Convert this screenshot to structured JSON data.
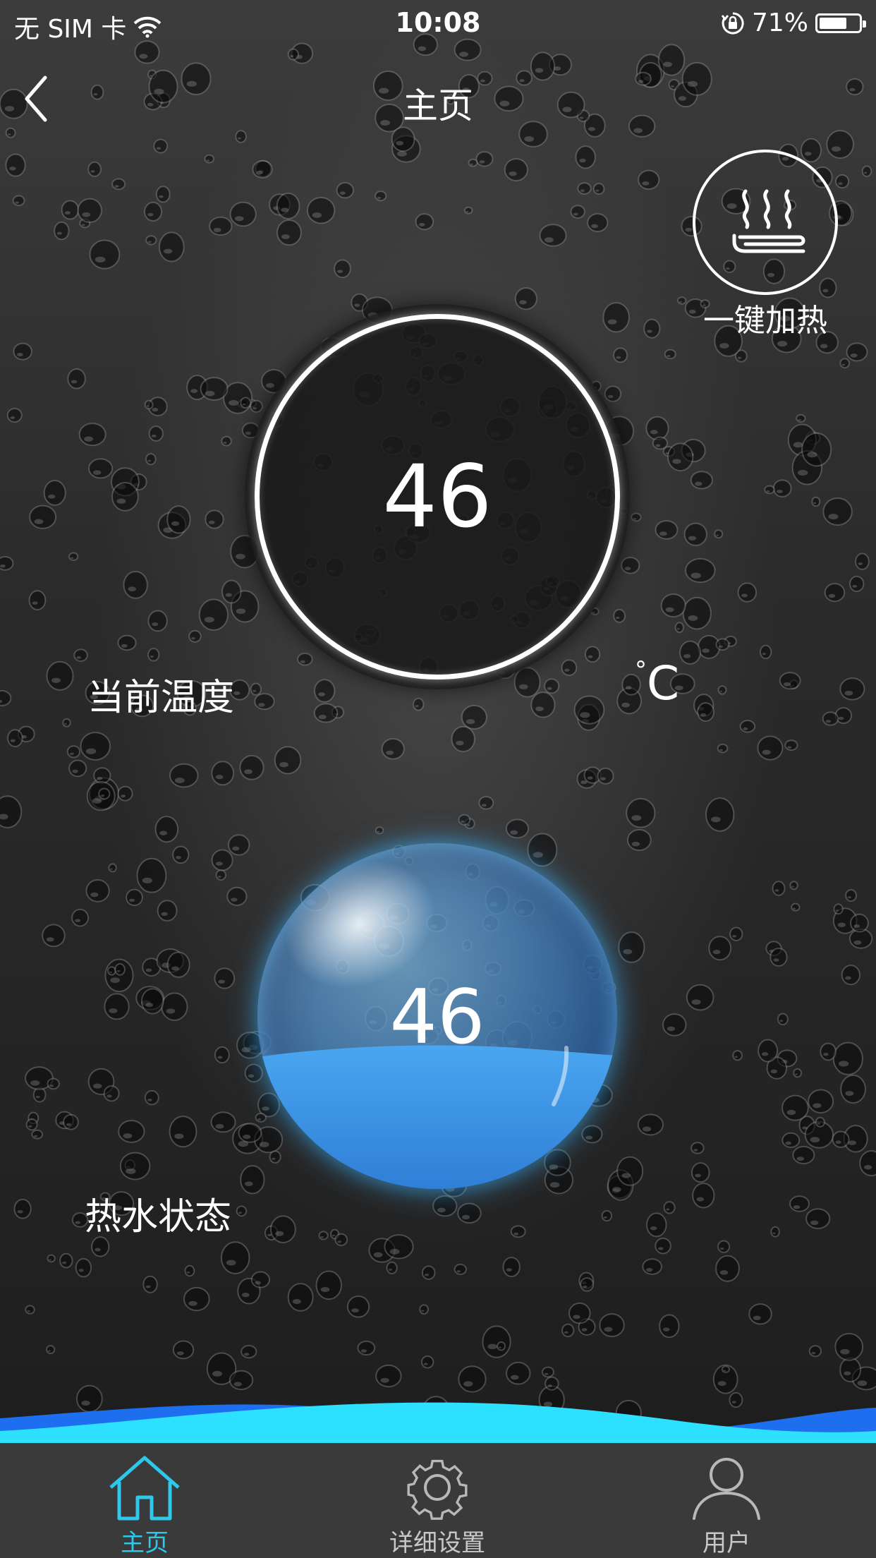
{
  "status_bar": {
    "carrier": "无 SIM 卡",
    "time": "10:08",
    "battery_percent": "71%",
    "battery_level": 0.71,
    "icons": [
      "wifi-icon",
      "rotation-lock-icon",
      "battery-icon"
    ]
  },
  "nav": {
    "title": "主页",
    "back_icon": "chevron-left-icon"
  },
  "quick_heat": {
    "label": "一键加热",
    "icon": "heat-wave-icon"
  },
  "temperature": {
    "value": "46",
    "label": "当前温度",
    "unit_degree": "°",
    "unit_letter": "C"
  },
  "hot_water": {
    "value": "46",
    "label": "热水状态",
    "fill_level": 0.46
  },
  "colors": {
    "accent": "#2ec8ea",
    "water": "#4aa6f0",
    "wave_dark": "#1e6ff0",
    "wave_light": "#2ee0ff"
  },
  "tabs": [
    {
      "label": "主页",
      "icon": "home-icon",
      "active": true
    },
    {
      "label": "详细设置",
      "icon": "gear-icon",
      "active": false
    },
    {
      "label": "用户",
      "icon": "user-icon",
      "active": false
    }
  ]
}
